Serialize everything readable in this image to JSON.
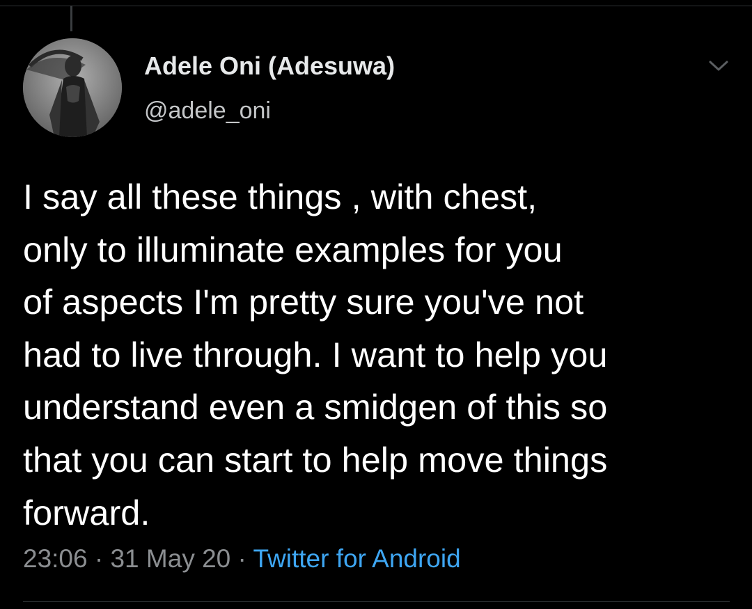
{
  "tweet": {
    "author": {
      "display_name": "Adele Oni (Adesuwa)",
      "handle": "@adele_oni",
      "avatar_icon": "profile-photo"
    },
    "text_lines": [
      "I say all these things , with chest,",
      "only to illuminate examples for you",
      "of aspects I'm pretty sure you've not",
      "had to live through. I want to help you",
      "understand even a smidgen of this so",
      "that you can start to help move things",
      "forward."
    ],
    "meta": {
      "time": "23:06",
      "date": "31 May 20",
      "separator": "·",
      "source": "Twitter for Android"
    },
    "menu_icon": "chevron-down-icon"
  },
  "colors": {
    "background": "#000000",
    "text_primary": "#ffffff",
    "text_secondary": "#8b8e91",
    "link": "#3ea6f2",
    "divider": "#2f3336"
  }
}
